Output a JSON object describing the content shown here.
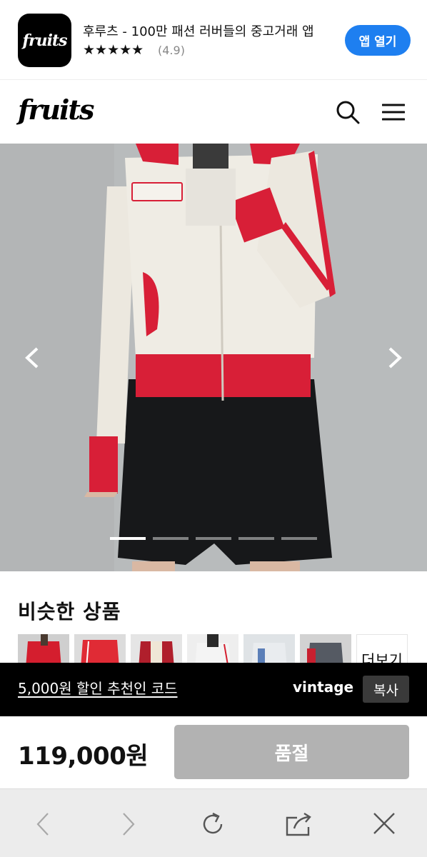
{
  "app_banner": {
    "logo_text": "fruits",
    "title": "후루츠 - 100만 패션 러버들의 중고거래 앱",
    "stars": "★★★★★",
    "rating": "(4.9)",
    "open_button": "앱 열기",
    "accent_color": "#1e7ff0"
  },
  "header": {
    "logo_text": "fruits",
    "icons": [
      "search-icon",
      "menu-icon"
    ]
  },
  "gallery": {
    "slide_count": 5,
    "active_index": 0,
    "icons": [
      "chevron-left-icon",
      "chevron-right-icon"
    ]
  },
  "similar": {
    "title": "비슷한 상품",
    "more_label": "더보기"
  },
  "promo": {
    "link_text": "5,000원 할인 추천인 코드",
    "code": "vintage",
    "copy_label": "복사"
  },
  "purchase": {
    "price": "119,000원",
    "status_button": "품절",
    "button_color": "#b2b2b2"
  },
  "browser_toolbar": {
    "icons": [
      "back-icon",
      "forward-icon",
      "reload-icon",
      "share-icon",
      "close-icon"
    ]
  }
}
